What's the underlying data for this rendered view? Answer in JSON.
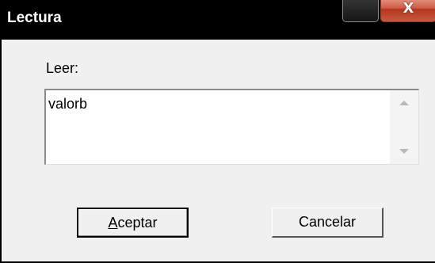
{
  "window": {
    "title": "Lectura",
    "close_glyph": "X",
    "minimize_icon": "minimize-icon",
    "close_icon": "close-icon"
  },
  "form": {
    "label": "Leer:",
    "value": "valorb",
    "scroll_up_icon": "scroll-up-arrow-icon",
    "scroll_down_icon": "scroll-down-arrow-icon"
  },
  "buttons": {
    "ok_label": "Aceptar",
    "cancel_label": "Cancelar"
  },
  "colors": {
    "titlebar": "#000000",
    "close_button": "#c9523a",
    "dialog_background": "#f0f0f0"
  }
}
